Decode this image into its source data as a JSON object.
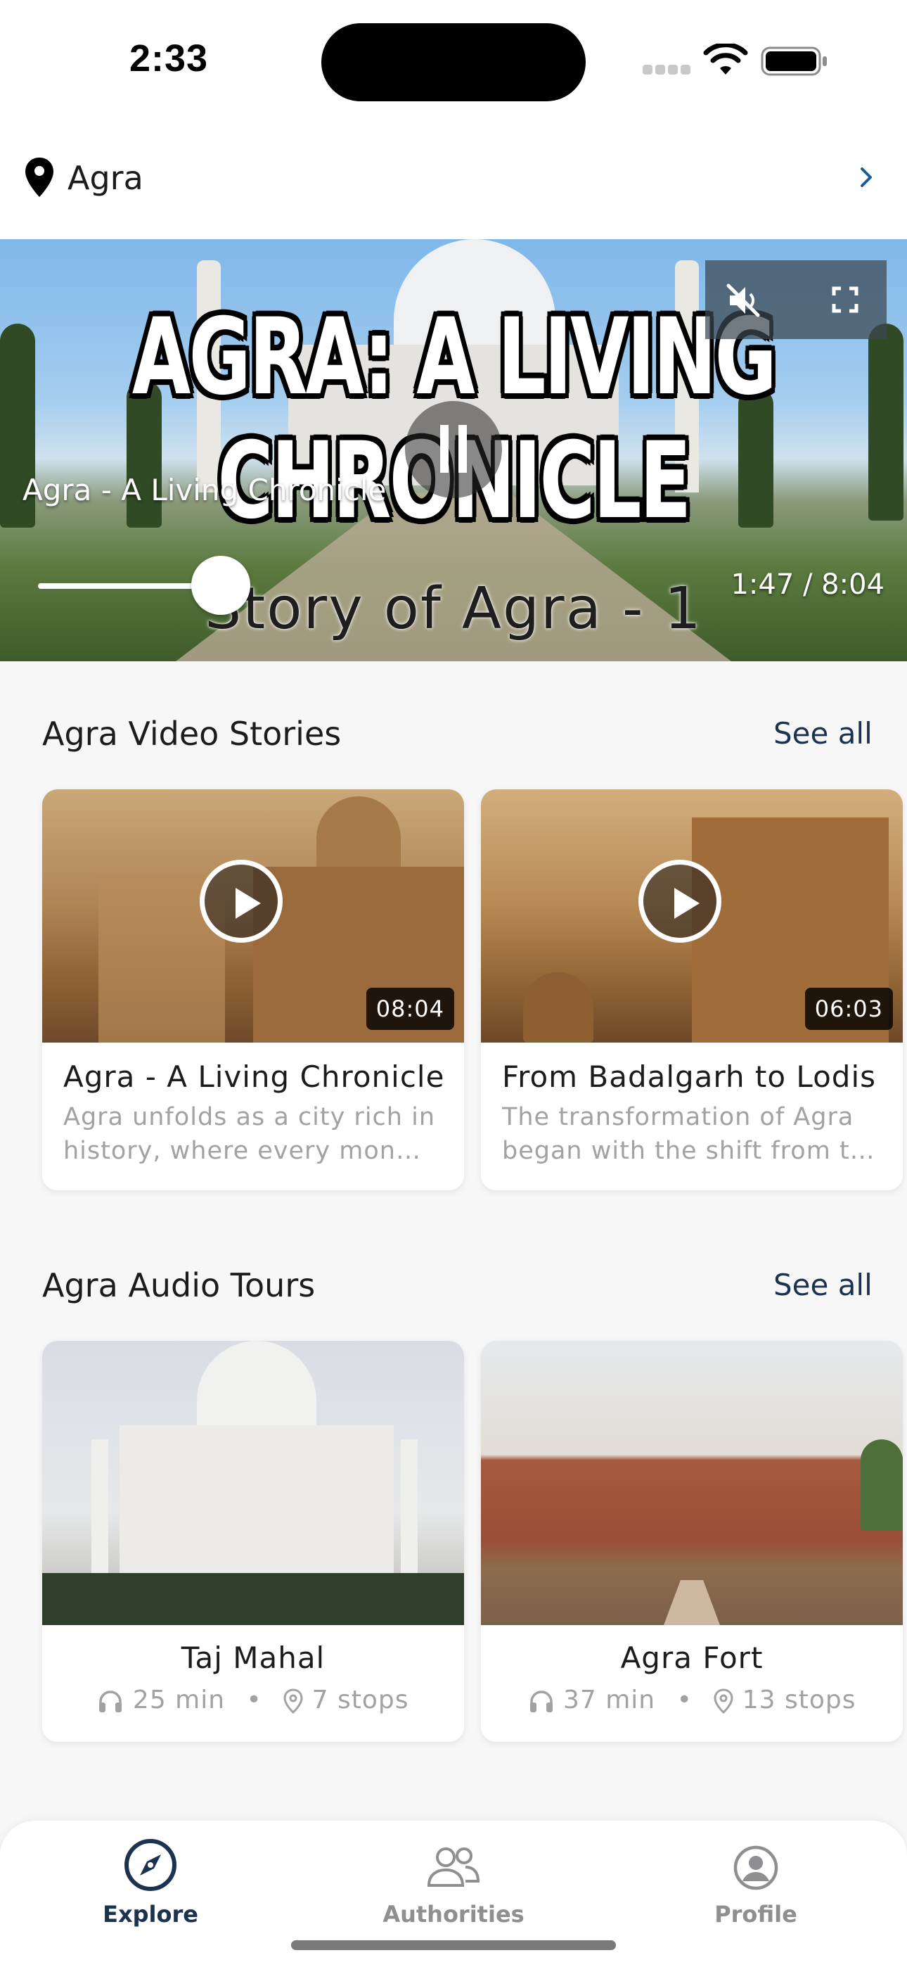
{
  "status_bar": {
    "time": "2:33"
  },
  "location": {
    "name": "Agra"
  },
  "video_player": {
    "overlay_title_line1": "AGRA: A LIVING",
    "overlay_title_line2": "CHRONICLE",
    "overlay_subtitle": "Story of Agra - 1",
    "label": "Agra - A Living Chronicle",
    "time": "1:47 / 8:04",
    "progress": 0.22
  },
  "video_stories": {
    "title": "Agra Video Stories",
    "see_all": "See all",
    "items": [
      {
        "title": "Agra - A Living Chronicle",
        "desc_line1": "Agra unfolds as a city rich in",
        "desc_line2": "history, where every monu...",
        "duration": "08:04"
      },
      {
        "title": "From Badalgarh to Lodis",
        "desc_line1": "The transformation of Agra",
        "desc_line2": "began with the shift from th...",
        "duration": "06:03"
      }
    ]
  },
  "audio_tours": {
    "title": "Agra Audio Tours",
    "see_all": "See all",
    "items": [
      {
        "title": "Taj Mahal",
        "duration": "25 min",
        "stops": "7 stops"
      },
      {
        "title": "Agra Fort",
        "duration": "37 min",
        "stops": "13 stops"
      }
    ]
  },
  "tab_bar": {
    "active_color": "#1c3350",
    "inactive_color": "#8e8e93",
    "tabs": [
      {
        "label": "Explore",
        "icon": "compass-icon",
        "active": true
      },
      {
        "label": "Authorities",
        "icon": "people-icon",
        "active": false
      },
      {
        "label": "Profile",
        "icon": "profile-icon",
        "active": false
      }
    ]
  }
}
